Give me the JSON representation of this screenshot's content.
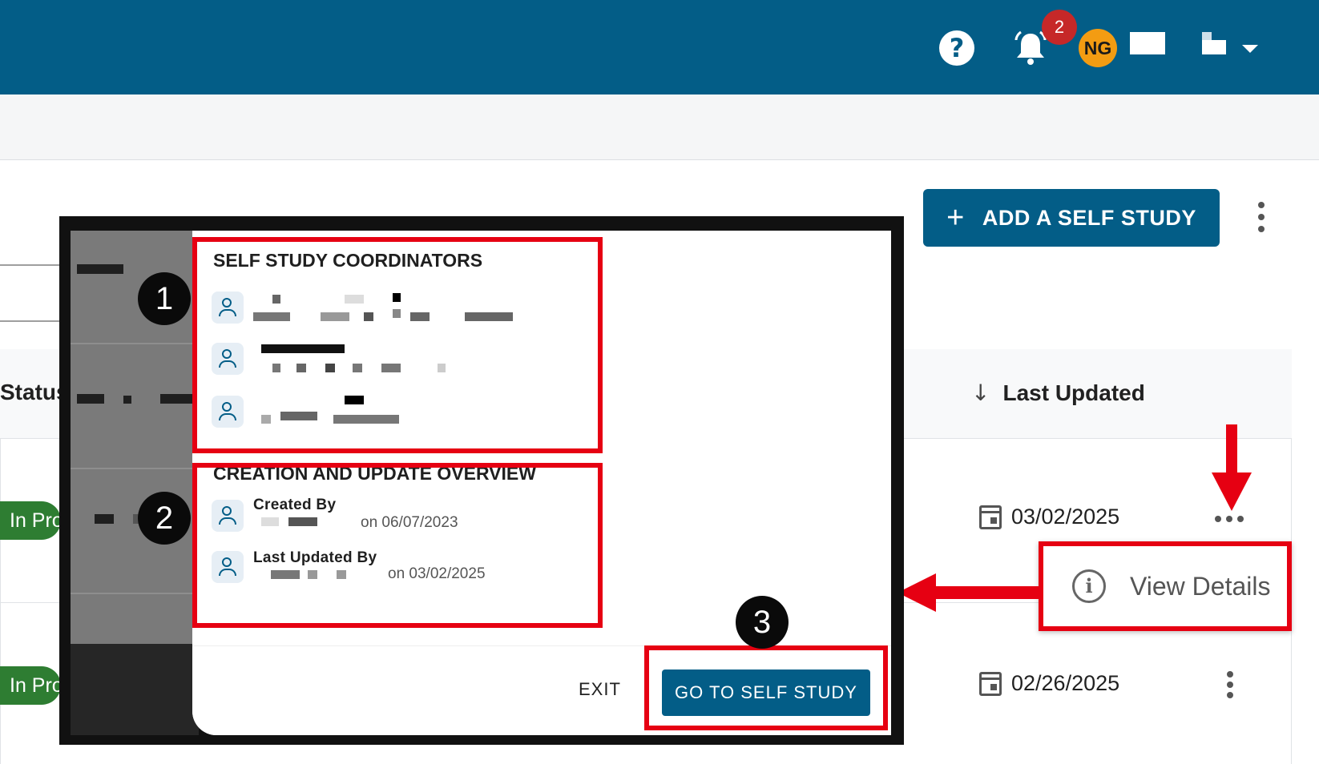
{
  "header": {
    "help_glyph": "?",
    "notification_count": "2",
    "avatar_initials": "NG"
  },
  "toolbar": {
    "add_plus": "+",
    "add_label": "ADD A SELF STUDY"
  },
  "table": {
    "columns": {
      "status": "Status",
      "last_updated": "Last Updated"
    },
    "sort_glyph": "↓",
    "rows": [
      {
        "status": "In Progress",
        "last_updated": "03/02/2025"
      },
      {
        "status": "In Progress",
        "last_updated": "02/26/2025"
      }
    ]
  },
  "menu": {
    "view_details": "View Details"
  },
  "dialog": {
    "coordinators_title": "SELF STUDY COORDINATORS",
    "overview_title": "CREATION AND UPDATE OVERVIEW",
    "created_by_label": "Created By",
    "created_on": "on 06/07/2023",
    "last_updated_by_label": "Last Updated By",
    "updated_on": "on 03/02/2025",
    "exit_label": "EXIT",
    "go_label": "GO TO SELF STUDY"
  },
  "annotations": {
    "step1": "1",
    "step2": "2",
    "step3": "3"
  },
  "colors": {
    "brand": "#035d87",
    "highlight": "#e60012",
    "status_in_progress": "#2e7d32",
    "avatar": "#f39c12",
    "badge": "#c62828"
  }
}
